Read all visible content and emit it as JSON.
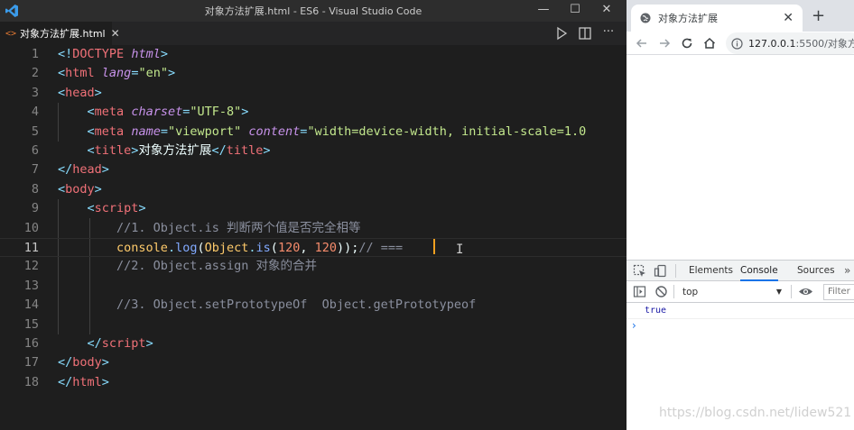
{
  "vscode": {
    "window_title": "对象方法扩展.html - ES6 - Visual Studio Code",
    "window_controls": {
      "minimize": "—",
      "maximize": "☐",
      "close": "✕"
    },
    "tab": {
      "icon": "<>",
      "label": "对象方法扩展.html",
      "close": "✕"
    },
    "more_actions": "···",
    "line_numbers": [
      "1",
      "2",
      "3",
      "4",
      "5",
      "6",
      "7",
      "8",
      "9",
      "10",
      "11",
      "12",
      "13",
      "14",
      "15",
      "16",
      "17",
      "18"
    ],
    "lines": {
      "l1": {
        "lt": "<!",
        "doctype": "DOCTYPE",
        "html": "html",
        "gt": ">"
      },
      "l2": {
        "lt": "<",
        "tag": "html",
        "attr": "lang",
        "eq": "=",
        "val": "\"en\"",
        "gt": ">"
      },
      "l3": {
        "lt": "<",
        "tag": "head",
        "gt": ">"
      },
      "l4": {
        "lt": "<",
        "tag": "meta",
        "attr": "charset",
        "eq": "=",
        "val": "\"UTF-8\"",
        "gt": ">"
      },
      "l5": {
        "lt": "<",
        "tag": "meta",
        "attr1": "name",
        "eq1": "=",
        "val1": "\"viewport\"",
        "attr2": "content",
        "eq2": "=",
        "val2": "\"width=device-width, initial-scale=1.0"
      },
      "l6": {
        "lt": "<",
        "tag": "title",
        "gt": ">",
        "text": "对象方法扩展",
        "lt2": "</",
        "tag2": "title",
        "gt2": ">"
      },
      "l7": {
        "lt": "</",
        "tag": "head",
        "gt": ">"
      },
      "l8": {
        "lt": "<",
        "tag": "body",
        "gt": ">"
      },
      "l9": {
        "lt": "<",
        "tag": "script",
        "gt": ">"
      },
      "l10": {
        "comment": "//1. Object.is 判断两个值是否完全相等"
      },
      "l11": {
        "console": "console",
        "dot1": ".",
        "log": "log",
        "p1": "(",
        "obj": "Object",
        "dot2": ".",
        "is": "is",
        "p2": "(",
        "n1": "120",
        "comma": ", ",
        "n2": "120",
        "close": "));",
        "comment": "// === "
      },
      "l12": {
        "comment": "//2. Object.assign 对象的合并"
      },
      "l14": {
        "comment": "//3. Object.setPrototypeOf  Object.getPrototypeof"
      },
      "l16": {
        "lt": "</",
        "tag": "script",
        "gt": ">"
      },
      "l17": {
        "lt": "</",
        "tag": "body",
        "gt": ">"
      },
      "l18": {
        "lt": "</",
        "tag": "html",
        "gt": ">"
      }
    },
    "ibeam": "I"
  },
  "browser": {
    "tab_title": "对象方法扩展",
    "tab_close": "✕",
    "new_tab": "+",
    "url_host": "127.0.0.1",
    "url_rest": ":5500/对象方",
    "devtools": {
      "tabs": {
        "elements": "Elements",
        "console": "Console",
        "sources": "Sources",
        "more": "»"
      },
      "context": "top",
      "context_caret": "▼",
      "filter_placeholder": "Filter",
      "log_output": "true",
      "prompt": "›"
    }
  },
  "watermark": "https://blog.csdn.net/lidew521",
  "colors": {
    "editor_bg": "#1e1e1e",
    "accent": "#1a73e8",
    "caret": "#f0a020"
  }
}
